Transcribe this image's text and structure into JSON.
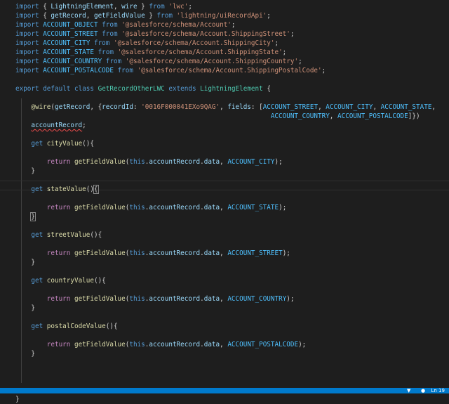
{
  "editor": {
    "lines": [
      [
        {
          "c": "kw",
          "t": "import"
        },
        {
          "c": "plain",
          "t": " { "
        },
        {
          "c": "var",
          "t": "LightningElement"
        },
        {
          "c": "plain",
          "t": ", "
        },
        {
          "c": "var",
          "t": "wire"
        },
        {
          "c": "plain",
          "t": " } "
        },
        {
          "c": "kw",
          "t": "from"
        },
        {
          "c": "plain",
          "t": " "
        },
        {
          "c": "str",
          "t": "'lwc'"
        },
        {
          "c": "plain",
          "t": ";"
        }
      ],
      [
        {
          "c": "kw",
          "t": "import"
        },
        {
          "c": "plain",
          "t": " { "
        },
        {
          "c": "var",
          "t": "getRecord"
        },
        {
          "c": "plain",
          "t": ", "
        },
        {
          "c": "var",
          "t": "getFieldValue"
        },
        {
          "c": "plain",
          "t": " } "
        },
        {
          "c": "kw",
          "t": "from"
        },
        {
          "c": "plain",
          "t": " "
        },
        {
          "c": "str",
          "t": "'lightning/uiRecordApi'"
        },
        {
          "c": "plain",
          "t": ";"
        }
      ],
      [
        {
          "c": "kw",
          "t": "import"
        },
        {
          "c": "plain",
          "t": " "
        },
        {
          "c": "const",
          "t": "ACCOUNT_OBJECT"
        },
        {
          "c": "plain",
          "t": " "
        },
        {
          "c": "kw",
          "t": "from"
        },
        {
          "c": "plain",
          "t": " "
        },
        {
          "c": "str",
          "t": "'@salesforce/schema/Account'"
        },
        {
          "c": "plain",
          "t": ";"
        }
      ],
      [
        {
          "c": "kw",
          "t": "import"
        },
        {
          "c": "plain",
          "t": " "
        },
        {
          "c": "const",
          "t": "ACCOUNT_STREET"
        },
        {
          "c": "plain",
          "t": " "
        },
        {
          "c": "kw",
          "t": "from"
        },
        {
          "c": "plain",
          "t": " "
        },
        {
          "c": "str",
          "t": "'@salesforce/schema/Account.ShippingStreet'"
        },
        {
          "c": "plain",
          "t": ";"
        }
      ],
      [
        {
          "c": "kw",
          "t": "import"
        },
        {
          "c": "plain",
          "t": " "
        },
        {
          "c": "const",
          "t": "ACCOUNT_CITY"
        },
        {
          "c": "plain",
          "t": " "
        },
        {
          "c": "kw",
          "t": "from"
        },
        {
          "c": "plain",
          "t": " "
        },
        {
          "c": "str",
          "t": "'@salesforce/schema/Account.ShippingCity'"
        },
        {
          "c": "plain",
          "t": ";"
        }
      ],
      [
        {
          "c": "kw",
          "t": "import"
        },
        {
          "c": "plain",
          "t": " "
        },
        {
          "c": "const",
          "t": "ACCOUNT_STATE"
        },
        {
          "c": "plain",
          "t": " "
        },
        {
          "c": "kw",
          "t": "from"
        },
        {
          "c": "plain",
          "t": " "
        },
        {
          "c": "str",
          "t": "'@salesforce/schema/Account.ShippingState'"
        },
        {
          "c": "plain",
          "t": ";"
        }
      ],
      [
        {
          "c": "kw",
          "t": "import"
        },
        {
          "c": "plain",
          "t": " "
        },
        {
          "c": "const",
          "t": "ACCOUNT_COUNTRY"
        },
        {
          "c": "plain",
          "t": " "
        },
        {
          "c": "kw",
          "t": "from"
        },
        {
          "c": "plain",
          "t": " "
        },
        {
          "c": "str",
          "t": "'@salesforce/schema/Account.ShippingCountry'"
        },
        {
          "c": "plain",
          "t": ";"
        }
      ],
      [
        {
          "c": "kw",
          "t": "import"
        },
        {
          "c": "plain",
          "t": " "
        },
        {
          "c": "const",
          "t": "ACCOUNT_POSTALCODE"
        },
        {
          "c": "plain",
          "t": " "
        },
        {
          "c": "kw",
          "t": "from"
        },
        {
          "c": "plain",
          "t": " "
        },
        {
          "c": "str",
          "t": "'@salesforce/schema/Account.ShippingPostalCode'"
        },
        {
          "c": "plain",
          "t": ";"
        }
      ],
      [],
      [
        {
          "c": "kw",
          "t": "export"
        },
        {
          "c": "plain",
          "t": " "
        },
        {
          "c": "kw",
          "t": "default"
        },
        {
          "c": "plain",
          "t": " "
        },
        {
          "c": "kw",
          "t": "class"
        },
        {
          "c": "plain",
          "t": " "
        },
        {
          "c": "cls",
          "t": "GetRecordOtherLWC"
        },
        {
          "c": "plain",
          "t": " "
        },
        {
          "c": "kw",
          "t": "extends"
        },
        {
          "c": "plain",
          "t": " "
        },
        {
          "c": "cls",
          "t": "LightningElement"
        },
        {
          "c": "plain",
          "t": " {"
        }
      ],
      [],
      [
        {
          "c": "plain",
          "t": "    "
        },
        {
          "c": "dec",
          "t": "@wire"
        },
        {
          "c": "plain",
          "t": "("
        },
        {
          "c": "var",
          "t": "getRecord"
        },
        {
          "c": "plain",
          "t": ", {"
        },
        {
          "c": "var",
          "t": "recordId"
        },
        {
          "c": "plain",
          "t": ": "
        },
        {
          "c": "str",
          "t": "'0016F000041EXo9QAG'"
        },
        {
          "c": "plain",
          "t": ", "
        },
        {
          "c": "var",
          "t": "fields"
        },
        {
          "c": "plain",
          "t": ": ["
        },
        {
          "c": "const",
          "t": "ACCOUNT_STREET"
        },
        {
          "c": "plain",
          "t": ", "
        },
        {
          "c": "const",
          "t": "ACCOUNT_CITY"
        },
        {
          "c": "plain",
          "t": ", "
        },
        {
          "c": "const",
          "t": "ACCOUNT_STATE"
        },
        {
          "c": "plain",
          "t": ","
        }
      ],
      [
        {
          "c": "plain",
          "t": "                                                                 "
        },
        {
          "c": "const",
          "t": "ACCOUNT_COUNTRY"
        },
        {
          "c": "plain",
          "t": ", "
        },
        {
          "c": "const",
          "t": "ACCOUNT_POSTALCODE"
        },
        {
          "c": "plain",
          "t": "]})"
        }
      ],
      [
        {
          "c": "plain",
          "t": "    "
        },
        {
          "c": "var squiggle",
          "t": "accountRecord"
        },
        {
          "c": "plain",
          "t": ";"
        }
      ],
      [],
      [
        {
          "c": "plain",
          "t": "    "
        },
        {
          "c": "kw",
          "t": "get"
        },
        {
          "c": "plain",
          "t": " "
        },
        {
          "c": "fn",
          "t": "cityValue"
        },
        {
          "c": "plain",
          "t": "(){"
        }
      ],
      [],
      [
        {
          "c": "plain",
          "t": "        "
        },
        {
          "c": "ctrl",
          "t": "return"
        },
        {
          "c": "plain",
          "t": " "
        },
        {
          "c": "fn",
          "t": "getFieldValue"
        },
        {
          "c": "plain",
          "t": "("
        },
        {
          "c": "kw",
          "t": "this"
        },
        {
          "c": "plain",
          "t": "."
        },
        {
          "c": "var",
          "t": "accountRecord"
        },
        {
          "c": "plain",
          "t": "."
        },
        {
          "c": "var",
          "t": "data"
        },
        {
          "c": "plain",
          "t": ", "
        },
        {
          "c": "const",
          "t": "ACCOUNT_CITY"
        },
        {
          "c": "plain",
          "t": ");"
        }
      ],
      [
        {
          "c": "plain",
          "t": "    }"
        }
      ],
      [],
      [
        {
          "c": "plain",
          "t": "    "
        },
        {
          "c": "kw",
          "t": "get"
        },
        {
          "c": "plain",
          "t": " "
        },
        {
          "c": "fn",
          "t": "stateValue"
        },
        {
          "c": "plain",
          "t": "()"
        },
        {
          "c": "plain cursor-bracket",
          "t": "{"
        }
      ],
      [],
      [
        {
          "c": "plain",
          "t": "        "
        },
        {
          "c": "ctrl",
          "t": "return"
        },
        {
          "c": "plain",
          "t": " "
        },
        {
          "c": "fn",
          "t": "getFieldValue"
        },
        {
          "c": "plain",
          "t": "("
        },
        {
          "c": "kw",
          "t": "this"
        },
        {
          "c": "plain",
          "t": "."
        },
        {
          "c": "var",
          "t": "accountRecord"
        },
        {
          "c": "plain",
          "t": "."
        },
        {
          "c": "var",
          "t": "data"
        },
        {
          "c": "plain",
          "t": ", "
        },
        {
          "c": "const",
          "t": "ACCOUNT_STATE"
        },
        {
          "c": "plain",
          "t": ");"
        }
      ],
      [
        {
          "c": "plain",
          "t": "    "
        },
        {
          "c": "plain cursor-bracket",
          "t": "}"
        }
      ],
      [],
      [
        {
          "c": "plain",
          "t": "    "
        },
        {
          "c": "kw",
          "t": "get"
        },
        {
          "c": "plain",
          "t": " "
        },
        {
          "c": "fn",
          "t": "streetValue"
        },
        {
          "c": "plain",
          "t": "(){"
        }
      ],
      [],
      [
        {
          "c": "plain",
          "t": "        "
        },
        {
          "c": "ctrl",
          "t": "return"
        },
        {
          "c": "plain",
          "t": " "
        },
        {
          "c": "fn",
          "t": "getFieldValue"
        },
        {
          "c": "plain",
          "t": "("
        },
        {
          "c": "kw",
          "t": "this"
        },
        {
          "c": "plain",
          "t": "."
        },
        {
          "c": "var",
          "t": "accountRecord"
        },
        {
          "c": "plain",
          "t": "."
        },
        {
          "c": "var",
          "t": "data"
        },
        {
          "c": "plain",
          "t": ", "
        },
        {
          "c": "const",
          "t": "ACCOUNT_STREET"
        },
        {
          "c": "plain",
          "t": ");"
        }
      ],
      [
        {
          "c": "plain",
          "t": "    }"
        }
      ],
      [],
      [
        {
          "c": "plain",
          "t": "    "
        },
        {
          "c": "kw",
          "t": "get"
        },
        {
          "c": "plain",
          "t": " "
        },
        {
          "c": "fn",
          "t": "countryValue"
        },
        {
          "c": "plain",
          "t": "(){"
        }
      ],
      [],
      [
        {
          "c": "plain",
          "t": "        "
        },
        {
          "c": "ctrl",
          "t": "return"
        },
        {
          "c": "plain",
          "t": " "
        },
        {
          "c": "fn",
          "t": "getFieldValue"
        },
        {
          "c": "plain",
          "t": "("
        },
        {
          "c": "kw",
          "t": "this"
        },
        {
          "c": "plain",
          "t": "."
        },
        {
          "c": "var",
          "t": "accountRecord"
        },
        {
          "c": "plain",
          "t": "."
        },
        {
          "c": "var",
          "t": "data"
        },
        {
          "c": "plain",
          "t": ", "
        },
        {
          "c": "const",
          "t": "ACCOUNT_COUNTRY"
        },
        {
          "c": "plain",
          "t": ");"
        }
      ],
      [
        {
          "c": "plain",
          "t": "    }"
        }
      ],
      [],
      [
        {
          "c": "plain",
          "t": "    "
        },
        {
          "c": "kw",
          "t": "get"
        },
        {
          "c": "plain",
          "t": " "
        },
        {
          "c": "fn",
          "t": "postalCodeValue"
        },
        {
          "c": "plain",
          "t": "(){"
        }
      ],
      [],
      [
        {
          "c": "plain",
          "t": "        "
        },
        {
          "c": "ctrl",
          "t": "return"
        },
        {
          "c": "plain",
          "t": " "
        },
        {
          "c": "fn",
          "t": "getFieldValue"
        },
        {
          "c": "plain",
          "t": "("
        },
        {
          "c": "kw",
          "t": "this"
        },
        {
          "c": "plain",
          "t": "."
        },
        {
          "c": "var",
          "t": "accountRecord"
        },
        {
          "c": "plain",
          "t": "."
        },
        {
          "c": "var",
          "t": "data"
        },
        {
          "c": "plain",
          "t": ", "
        },
        {
          "c": "const",
          "t": "ACCOUNT_POSTALCODE"
        },
        {
          "c": "plain",
          "t": ");"
        }
      ],
      [
        {
          "c": "plain",
          "t": "    }"
        }
      ],
      [],
      [],
      [],
      [],
      [
        {
          "c": "plain",
          "t": "}"
        }
      ]
    ]
  },
  "colors": {
    "background": "#1e1e1e",
    "statusbar": "#007acc"
  },
  "statusbar": {
    "right_text": "Ln 19"
  }
}
